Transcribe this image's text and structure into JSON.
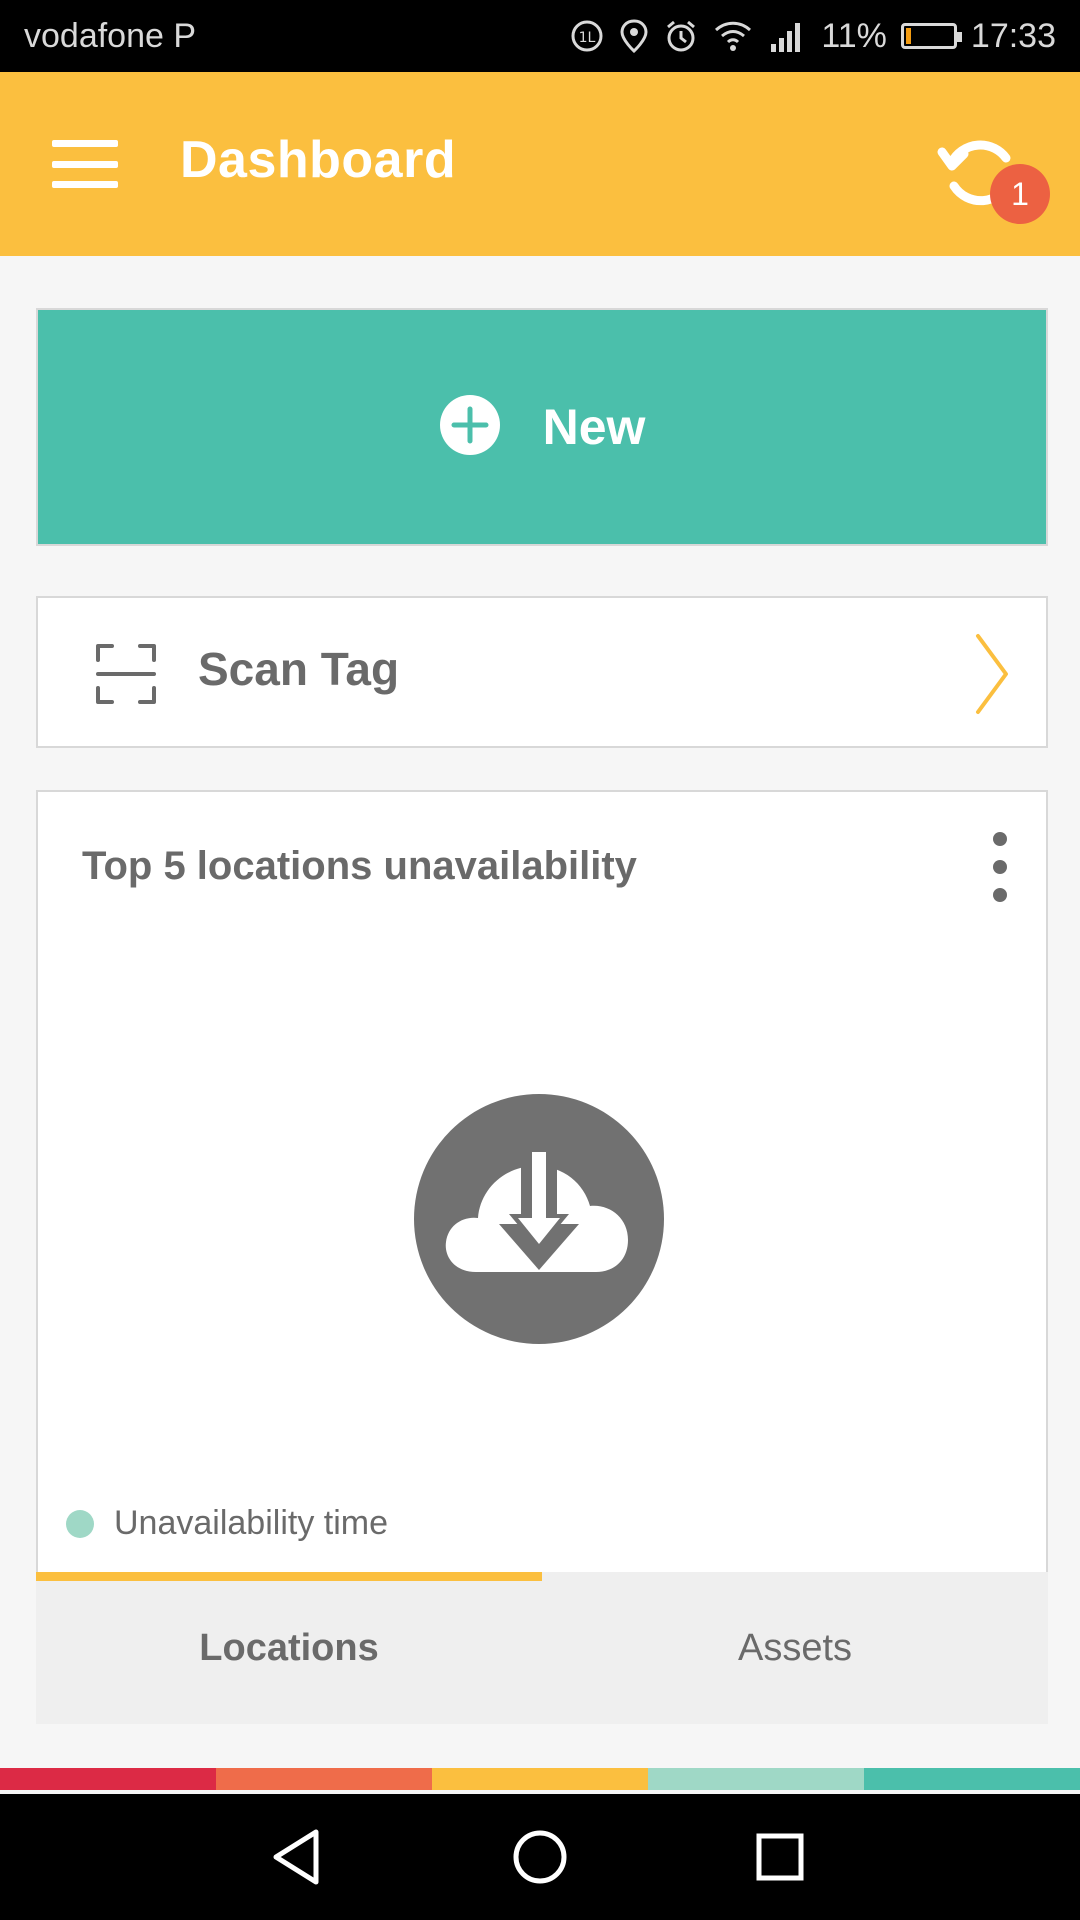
{
  "status_bar": {
    "carrier": "vodafone P",
    "battery": "11%",
    "battery_level": 0.11,
    "time": "17:33",
    "icons": [
      "data-saver-icon",
      "location-icon",
      "alarm-icon",
      "wifi-icon",
      "signal-icon",
      "battery-icon"
    ]
  },
  "app_bar": {
    "title": "Dashboard",
    "menu_icon": "hamburger-menu-icon",
    "sync_icon": "sync-icon",
    "sync_badge": "1",
    "color": "#fbbf3f"
  },
  "new_button": {
    "label": "New",
    "icon": "plus-circle-icon",
    "color": "#4bbfab"
  },
  "scan_tag": {
    "label": "Scan Tag",
    "icon": "scan-frame-icon",
    "chevron": "chevron-right-icon"
  },
  "chart_card": {
    "title": "Top 5 locations unavailability",
    "more_icon": "more-vertical-icon",
    "placeholder_icon": "cloud-download-icon",
    "legend": [
      {
        "label": "Unavailability time",
        "color": "#9fd8c6"
      }
    ]
  },
  "tabs": [
    {
      "label": "Locations",
      "active": true
    },
    {
      "label": "Assets",
      "active": false
    }
  ],
  "color_strip": [
    "#dc2a45",
    "#ef6c4a",
    "#fbbf3f",
    "#9fd8c6",
    "#4bbfab"
  ],
  "nav_bar": {
    "back_icon": "back-triangle-icon",
    "home_icon": "home-circle-icon",
    "recents_icon": "recents-square-icon"
  }
}
